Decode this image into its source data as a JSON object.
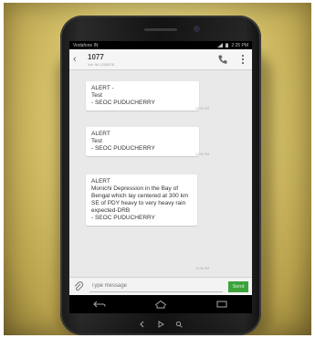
{
  "status_bar": {
    "carrier": "Vodafone IN",
    "time": "2:35 PM"
  },
  "header": {
    "contact_name": "1077",
    "contact_subtitle": "Vol: 94 1234578",
    "call_icon": "phone-icon",
    "menu_icon": "overflow-menu-icon"
  },
  "messages": [
    {
      "text": "ALERT -\nTest\n- SEOC PUDUCHERRY",
      "time": "12:33 PM"
    },
    {
      "text": "ALERT\nTest\n- SEOC PUDUCHERRY",
      "time": "12:34 PM"
    },
    {
      "text": "ALERT\nMonichi Depression in the Bay of Bengal which lay centered at 300 km SE of PDY heavy to very heavy rain expected-DRB\n- SEOC PUDUCHERRY",
      "time": "12:35 PM"
    }
  ],
  "compose": {
    "placeholder": "Type message",
    "send_label": "Send",
    "attach_icon": "paperclip-icon"
  },
  "nav_icons": [
    "back-icon",
    "home-icon",
    "recents-icon"
  ],
  "colors": {
    "send_button": "#3ca33c",
    "status_bar": "#000000",
    "background": "#e9e9e9"
  }
}
